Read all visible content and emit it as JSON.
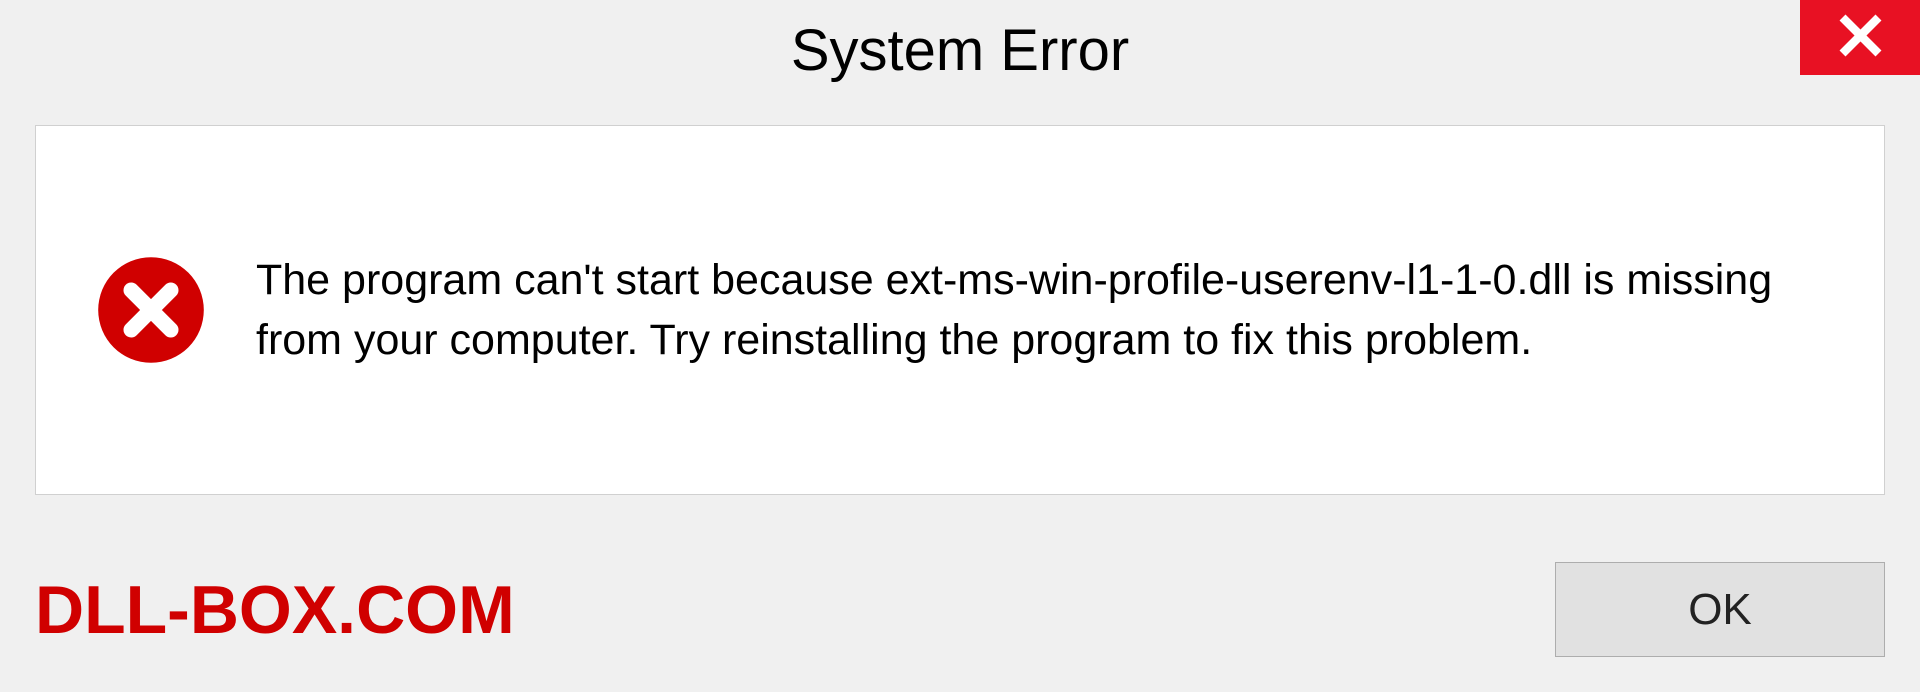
{
  "titlebar": {
    "title": "System Error"
  },
  "content": {
    "message": "The program can't start because ext-ms-win-profile-userenv-l1-1-0.dll is missing from your computer. Try reinstalling the program to fix this problem."
  },
  "footer": {
    "watermark": "DLL-BOX.COM",
    "ok_label": "OK"
  },
  "colors": {
    "close_bg": "#e81123",
    "error_icon": "#d00000",
    "watermark": "#d00000"
  }
}
